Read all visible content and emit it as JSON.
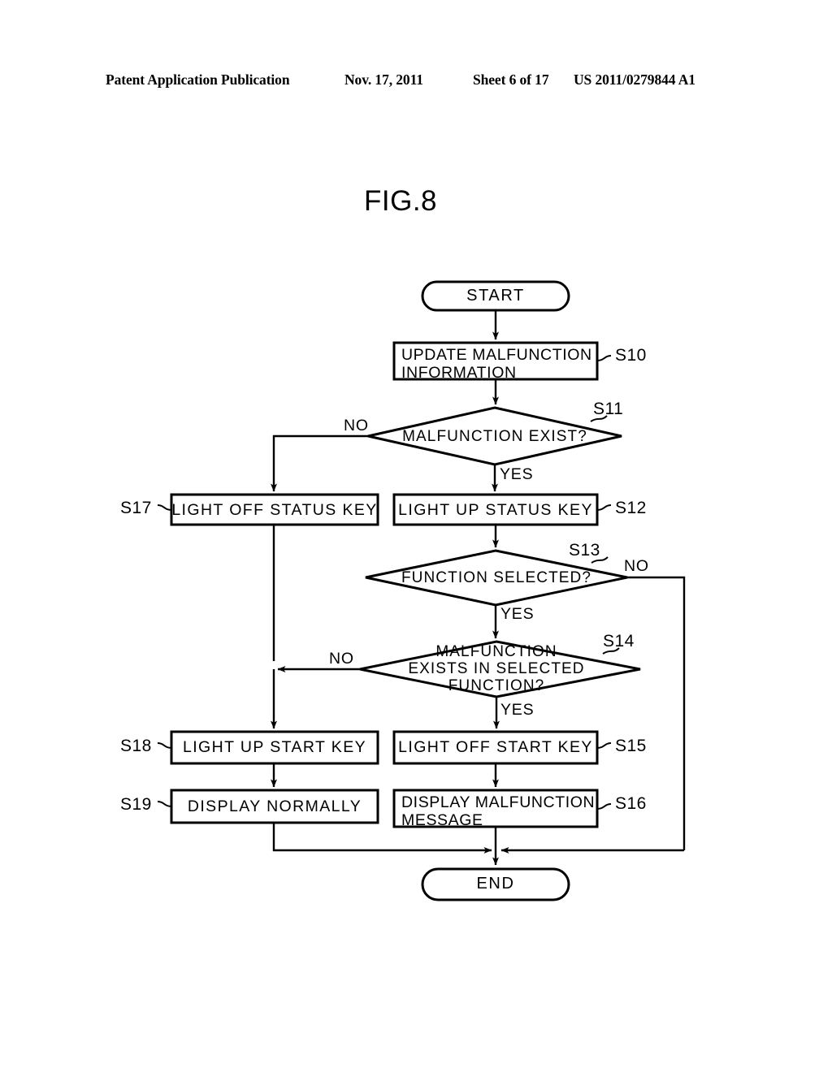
{
  "header": {
    "publication": "Patent Application Publication",
    "date": "Nov. 17, 2011",
    "sheet": "Sheet 6 of 17",
    "patent_number": "US 2011/0279844 A1"
  },
  "figure": {
    "title": "FIG.8"
  },
  "flowchart": {
    "type": "flowchart",
    "start": {
      "label": "START"
    },
    "end": {
      "label": "END"
    },
    "nodes": [
      {
        "id": "S10",
        "shape": "process",
        "step": "S10",
        "step_side": "right",
        "text": "UPDATE MALFUNCTION\nINFORMATION",
        "align": "left"
      },
      {
        "id": "S11",
        "shape": "decision",
        "step": "S11",
        "step_side": "right",
        "text": "MALFUNCTION EXIST?"
      },
      {
        "id": "S17",
        "shape": "process",
        "step": "S17",
        "step_side": "left",
        "text": "LIGHT OFF STATUS KEY",
        "align": "center"
      },
      {
        "id": "S12",
        "shape": "process",
        "step": "S12",
        "step_side": "right",
        "text": "LIGHT UP STATUS KEY",
        "align": "center"
      },
      {
        "id": "S13",
        "shape": "decision",
        "step": "S13",
        "step_side": "right",
        "text": "FUNCTION SELECTED?"
      },
      {
        "id": "S14",
        "shape": "decision",
        "step": "S14",
        "step_side": "right",
        "text": "MALFUNCTION\nEXISTS IN SELECTED\nFUNCTION?"
      },
      {
        "id": "S18",
        "shape": "process",
        "step": "S18",
        "step_side": "left",
        "text": "LIGHT UP START KEY",
        "align": "center"
      },
      {
        "id": "S15",
        "shape": "process",
        "step": "S15",
        "step_side": "right",
        "text": "LIGHT OFF START KEY",
        "align": "center"
      },
      {
        "id": "S19",
        "shape": "process",
        "step": "S19",
        "step_side": "left",
        "text": "DISPLAY NORMALLY",
        "align": "center"
      },
      {
        "id": "S16",
        "shape": "process",
        "step": "S16",
        "step_side": "right",
        "text": "DISPLAY MALFUNCTION\nMESSAGE",
        "align": "left"
      }
    ],
    "edge_labels": {
      "s11_no": "NO",
      "s11_yes": "YES",
      "s13_no": "NO",
      "s13_yes": "YES",
      "s14_no": "NO",
      "s14_yes": "YES"
    }
  },
  "colors": {
    "stroke": "#000000",
    "background": "#ffffff"
  }
}
